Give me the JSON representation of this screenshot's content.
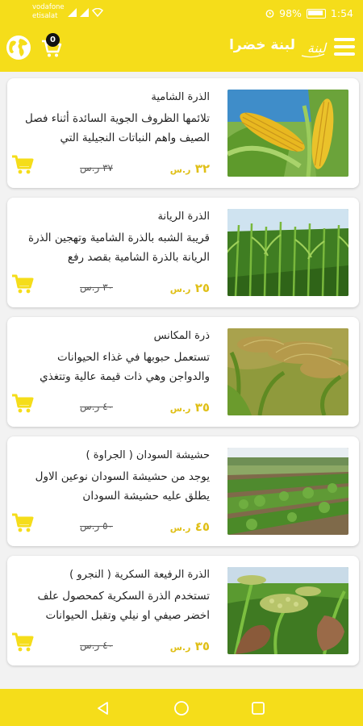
{
  "status": {
    "carrier_line1": "vodafone",
    "carrier_line2": "etisalat",
    "battery": "98%",
    "time": "1:54"
  },
  "appbar": {
    "title": "لبنة خضرا",
    "cart_count": "0",
    "logo_text": "لبنة"
  },
  "colors": {
    "accent": "#f5dd1a",
    "price": "#e0c019"
  },
  "products": [
    {
      "name": "الذرة الشامية",
      "description": "تلائمها الظروف الجوية السائدة أثناء فصل الصيف واهم النباتات النجيلية التي",
      "price": "٣٢",
      "currency": "ر.س",
      "old_price": "٣٧ ر.س",
      "image": "corn-cobs"
    },
    {
      "name": "الذرة الريانة",
      "description": "قريبة الشبه بالذرة الشامية وتهجين الذرة الريانة بالذرة الشامية بقصد رفع",
      "price": "٢٥",
      "currency": "ر.س",
      "old_price": "٣٠ ر.س",
      "image": "green-field"
    },
    {
      "name": "ذرة المكانس",
      "description": "تستعمل حبوبها في غذاء الحيوانات والدواجن وهي ذات قيمة عالية وتتغذي",
      "price": "٣٥",
      "currency": "ر.س",
      "old_price": "٤٠ ر.س",
      "image": "broomcorn"
    },
    {
      "name": "حشيشة السودان ( الجراوة )",
      "description": "يوجد من حشيشة السودان نوعين الاول يطلق عليه حشيشة السودان",
      "price": "٤٥",
      "currency": "ر.س",
      "old_price": "٥٠ ر.س",
      "image": "field-rows"
    },
    {
      "name": "الذرة الرفيعة السكرية ( النجرو )",
      "description": "تستخدم الذرة السكرية كمحصول علف اخضر صيفي او نيلي وتقبل الحيوانات",
      "price": "٣٥",
      "currency": "ر.س",
      "old_price": "٤٠ ر.س",
      "image": "sorghum-hand"
    }
  ]
}
